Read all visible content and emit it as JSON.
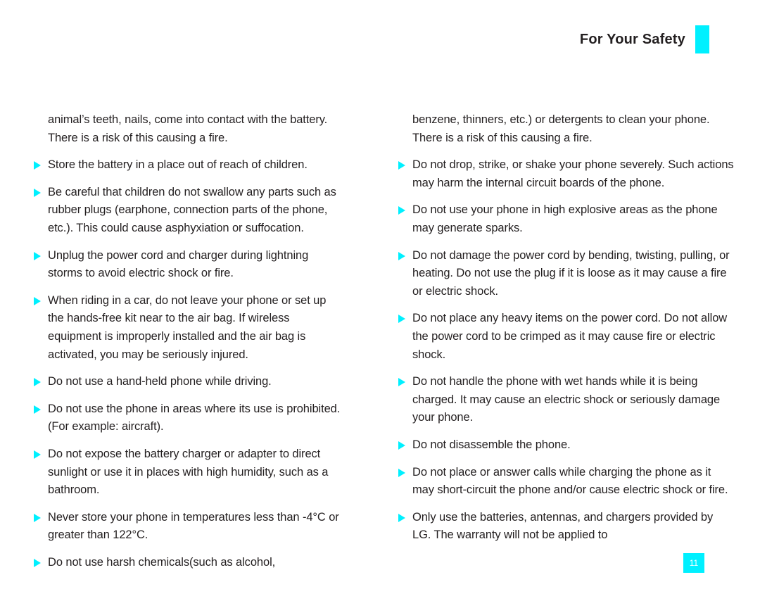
{
  "header": {
    "title": "For Your Safety",
    "accent_color": "#00f0ff"
  },
  "page_number": "11",
  "bullet_icon": "triangle-right-icon",
  "columns": {
    "left": [
      {
        "type": "continuation",
        "text": "animal’s teeth, nails, come into contact with the battery. There is a risk of this causing a fire."
      },
      {
        "type": "bullet",
        "text": "Store the battery in a place out of reach of children."
      },
      {
        "type": "bullet",
        "text": "Be careful that children do not swallow any parts such as rubber plugs (earphone, connection parts of the phone, etc.). This could cause asphyxiation or suffocation."
      },
      {
        "type": "bullet",
        "text": "Unplug the power cord and charger during lightning storms to avoid electric shock or fire."
      },
      {
        "type": "bullet",
        "text": "When riding in a car, do not leave your phone or set up the hands-free kit near to the air bag. If wireless equipment is improperly installed and the air bag is activated, you may be seriously injured."
      },
      {
        "type": "bullet",
        "text": "Do not use a hand-held phone while driving."
      },
      {
        "type": "bullet",
        "text": "Do not use the phone in areas where its use is prohibited. (For example: aircraft)."
      },
      {
        "type": "bullet",
        "text": "Do not expose the battery charger or adapter to direct sunlight or use it in places with high humidity, such as a bathroom."
      },
      {
        "type": "bullet",
        "text": "Never store your phone in temperatures less than -4°C or greater than 122°C."
      },
      {
        "type": "bullet",
        "text": "Do not use harsh chemicals(such as alcohol,"
      }
    ],
    "right": [
      {
        "type": "continuation",
        "text": "benzene, thinners, etc.) or detergents to clean your phone. There is a risk of this causing a fire."
      },
      {
        "type": "bullet",
        "text": "Do not drop, strike, or shake your phone severely. Such actions may harm the internal circuit boards of the phone."
      },
      {
        "type": "bullet",
        "text": "Do not use your phone in high explosive areas as the phone may generate sparks."
      },
      {
        "type": "bullet",
        "text": "Do not damage the power cord by bending, twisting, pulling, or heating. Do not use the plug if it is loose as it may cause a fire or electric shock."
      },
      {
        "type": "bullet",
        "text": "Do not place any heavy items on the power cord. Do not allow the power cord to be crimped as it may cause fire or electric shock."
      },
      {
        "type": "bullet",
        "text": "Do not handle the phone with wet hands while it is being charged. It may cause an electric shock or seriously damage your phone."
      },
      {
        "type": "bullet",
        "text": "Do not disassemble the phone."
      },
      {
        "type": "bullet",
        "text": "Do not place or answer calls while charging the phone as it may short-circuit the phone and/or cause electric shock or fire."
      },
      {
        "type": "bullet",
        "text": "Only use the batteries, antennas, and chargers provided by LG. The warranty will not be applied to"
      }
    ]
  }
}
